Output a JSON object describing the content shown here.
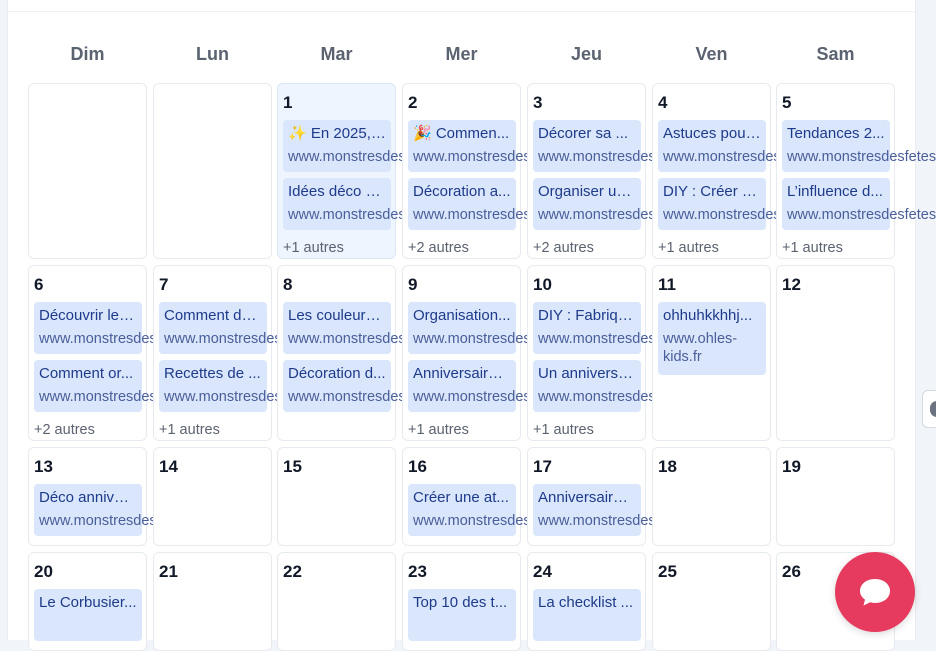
{
  "weekdays": [
    "Dim",
    "Lun",
    "Mar",
    "Mer",
    "Jeu",
    "Ven",
    "Sam"
  ],
  "weeks": [
    [
      {
        "day": "",
        "events": [],
        "more": ""
      },
      {
        "day": "",
        "events": [],
        "more": ""
      },
      {
        "day": "1",
        "today": true,
        "events": [
          {
            "title": "✨ En 2025, ...",
            "url": "www.monstresdesfetes.com"
          },
          {
            "title": "Idées déco p...",
            "url": "www.monstresdesfetes.com"
          }
        ],
        "more": "+1 autres"
      },
      {
        "day": "2",
        "events": [
          {
            "title": "🎉 Commen...",
            "url": "www.monstresdesfetes.com"
          },
          {
            "title": "Décoration a...",
            "url": "www.monstresdesfetes.com"
          }
        ],
        "more": "+2 autres"
      },
      {
        "day": "3",
        "events": [
          {
            "title": "Décorer sa ...",
            "url": "www.monstresdesfetes.com"
          },
          {
            "title": "Organiser un...",
            "url": "www.monstresdesfetes.com"
          }
        ],
        "more": "+2 autres"
      },
      {
        "day": "4",
        "events": [
          {
            "title": "Astuces pour...",
            "url": "www.monstresdesfetes.com"
          },
          {
            "title": "DIY : Créer u...",
            "url": "www.monstresdesfetes.com"
          }
        ],
        "more": "+1 autres"
      },
      {
        "day": "5",
        "events": [
          {
            "title": "Tendances 2...",
            "url": "www.monstresdesfetes.com"
          },
          {
            "title": "L’influence d...",
            "url": "www.monstresdesfetes.com"
          }
        ],
        "more": "+1 autres"
      }
    ],
    [
      {
        "day": "6",
        "events": [
          {
            "title": "Découvrir les...",
            "url": "www.monstresdesfetes.com"
          },
          {
            "title": "Comment or...",
            "url": "www.monstresdesfetes.com"
          }
        ],
        "more": "+2 autres"
      },
      {
        "day": "7",
        "events": [
          {
            "title": "Comment dé...",
            "url": "www.monstresdesfetes.com"
          },
          {
            "title": "Recettes de ...",
            "url": "www.monstresdesfetes.com"
          }
        ],
        "more": "+1 autres"
      },
      {
        "day": "8",
        "events": [
          {
            "title": "Les couleurs ...",
            "url": "www.monstresdesfetes.com"
          },
          {
            "title": "Décoration d...",
            "url": "www.monstresdesfetes.com"
          }
        ],
        "more": ""
      },
      {
        "day": "9",
        "events": [
          {
            "title": "Organisation...",
            "url": "www.monstresdesfetes.com"
          },
          {
            "title": "Anniversaire ...",
            "url": "www.monstresdesfetes.com"
          }
        ],
        "more": "+1 autres"
      },
      {
        "day": "10",
        "events": [
          {
            "title": "DIY : Fabriqu...",
            "url": "www.monstresdesfetes.com"
          },
          {
            "title": "Un anniversa...",
            "url": "www.monstresdesfetes.com"
          }
        ],
        "more": "+1 autres"
      },
      {
        "day": "11",
        "events": [
          {
            "title": "ohhuhkkhhj...",
            "url": "www.ohles-kids.fr",
            "wrap": true
          }
        ],
        "more": ""
      },
      {
        "day": "12",
        "events": [],
        "more": ""
      }
    ],
    [
      {
        "day": "13",
        "events": [
          {
            "title": "Déco anniver...",
            "url": "www.monstresdesfetes.com"
          }
        ],
        "more": ""
      },
      {
        "day": "14",
        "events": [],
        "more": ""
      },
      {
        "day": "15",
        "events": [],
        "more": ""
      },
      {
        "day": "16",
        "events": [
          {
            "title": "Créer une at...",
            "url": "www.monstresdesfetes.com"
          }
        ],
        "more": ""
      },
      {
        "day": "17",
        "events": [
          {
            "title": "Anniversaire ...",
            "url": "www.monstresdesfetes.com"
          }
        ],
        "more": ""
      },
      {
        "day": "18",
        "events": [],
        "more": ""
      },
      {
        "day": "19",
        "events": [],
        "more": ""
      }
    ],
    [
      {
        "day": "20",
        "events": [
          {
            "title": "Le Corbusier...",
            "url": ""
          }
        ],
        "more": ""
      },
      {
        "day": "21",
        "events": [],
        "more": ""
      },
      {
        "day": "22",
        "events": [],
        "more": ""
      },
      {
        "day": "23",
        "events": [
          {
            "title": "Top 10 des t...",
            "url": ""
          }
        ],
        "more": ""
      },
      {
        "day": "24",
        "events": [
          {
            "title": "La checklist ...",
            "url": ""
          }
        ],
        "more": ""
      },
      {
        "day": "25",
        "events": [],
        "more": ""
      },
      {
        "day": "26",
        "events": [],
        "more": ""
      }
    ]
  ],
  "colors": {
    "event_bg": "#d9e6fb",
    "today_bg": "#eef5ff",
    "chat_button": "#e63a5e"
  },
  "icons": {
    "chat": "chat-bubble-icon",
    "side_handle": "side-panel-handle-icon"
  }
}
